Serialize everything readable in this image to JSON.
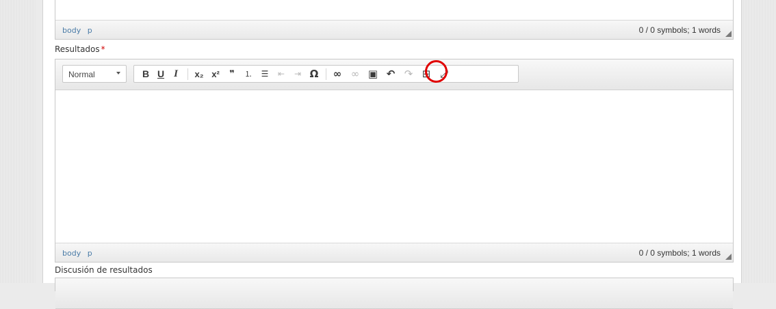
{
  "editors": [
    {
      "path": [
        "body",
        "p"
      ],
      "count": "0 / 0 symbols; 1 words"
    },
    {
      "label": "Resultados",
      "required_mark": "*",
      "path": [
        "body",
        "p"
      ],
      "count": "0 / 0 symbols; 1 words"
    }
  ],
  "next_label": "Discusión de resultados",
  "toolbar": {
    "format_value": "Normal",
    "buttons": [
      {
        "name": "bold-button",
        "glyph": "B"
      },
      {
        "name": "underline-button",
        "glyph": "U"
      },
      {
        "name": "italic-button",
        "glyph": "I"
      },
      {
        "name": "subscript-button",
        "glyph": "x₂"
      },
      {
        "name": "superscript-button",
        "glyph": "x²"
      },
      {
        "name": "blockquote-button",
        "glyph": "❞"
      },
      {
        "name": "numbered-list-button",
        "glyph": "⒈"
      },
      {
        "name": "bulleted-list-button",
        "glyph": "☰"
      },
      {
        "name": "outdent-button",
        "glyph": "⇤"
      },
      {
        "name": "indent-button",
        "glyph": "⇥"
      },
      {
        "name": "special-char-button",
        "glyph": "Ω"
      },
      {
        "name": "link-button",
        "glyph": "∞"
      },
      {
        "name": "unlink-button",
        "glyph": "∞"
      },
      {
        "name": "image-button",
        "glyph": "▣"
      },
      {
        "name": "undo-button",
        "glyph": "↶"
      },
      {
        "name": "redo-button",
        "glyph": "↷"
      },
      {
        "name": "table-button",
        "glyph": "⊞"
      },
      {
        "name": "maximize-button",
        "glyph": "⤢"
      }
    ]
  },
  "colors": {
    "highlight": "#e00000",
    "required": "#d00000",
    "path": "#4a7ba7"
  }
}
